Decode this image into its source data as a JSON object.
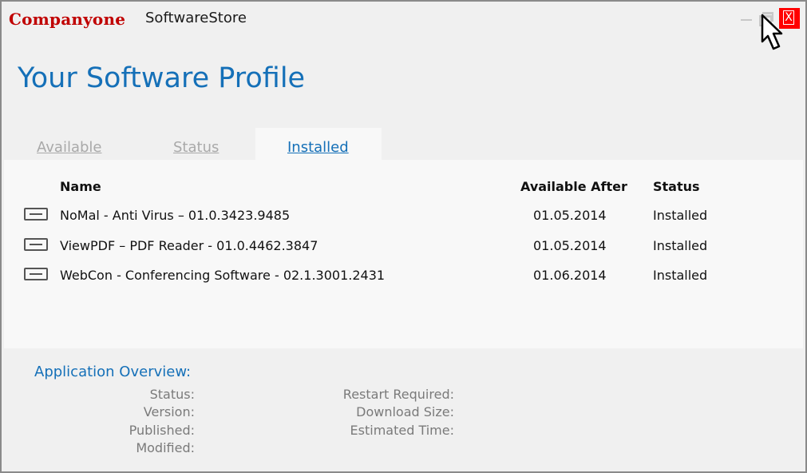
{
  "titlebar": {
    "brand": "Companyone",
    "app_name": "SoftwareStore",
    "close_label": "X"
  },
  "heading": "Your Software Profile",
  "tabs": [
    {
      "label": "Available",
      "active": false
    },
    {
      "label": "Status",
      "active": false
    },
    {
      "label": "Installed",
      "active": true
    }
  ],
  "table": {
    "columns": [
      "Name",
      "Available After",
      "Status"
    ],
    "rows": [
      {
        "name": "NoMal - Anti Virus – 01.0.3423.9485",
        "available_after": "01.05.2014",
        "status": "Installed"
      },
      {
        "name": "ViewPDF – PDF Reader  - 01.0.4462.3847",
        "available_after": "01.05.2014",
        "status": "Installed"
      },
      {
        "name": "WebCon - Conferencing Software - 02.1.3001.2431",
        "available_after": "01.06.2014",
        "status": "Installed"
      }
    ]
  },
  "overview": {
    "title": "Application Overview:",
    "left_labels": [
      "Status:",
      "Version:",
      "Published:",
      "Modified:"
    ],
    "right_labels": [
      "Restart Required:",
      "Download Size:",
      "Estimated Time:"
    ]
  },
  "colors": {
    "brand": "#c00000",
    "accent": "#1570b8",
    "close": "#ff0000"
  }
}
